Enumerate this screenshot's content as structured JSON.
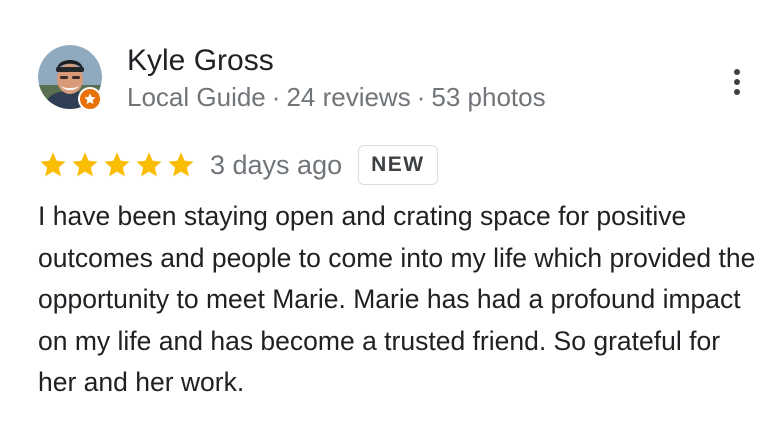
{
  "reviewer": {
    "name": "Kyle Gross",
    "badge_icon": "local-guide-star-icon",
    "meta": {
      "label": "Local Guide",
      "reviews": "24 reviews",
      "photos": "53 photos",
      "separator": "·"
    }
  },
  "more_options_icon": "vertical-ellipsis-icon",
  "review": {
    "stars": 5,
    "max_stars": 5,
    "date": "3 days ago",
    "badge": "NEW",
    "text": "I have been staying open and crating space for positive outcomes and people to come into my life which provided the opportunity to meet Marie. Marie has had a profound impact on my life and has become a trusted friend. So grateful for her and her work."
  },
  "colors": {
    "star": "#fbbc04",
    "guide_badge": "#e8710a",
    "secondary_text": "#70757a",
    "primary_text": "#202124"
  }
}
